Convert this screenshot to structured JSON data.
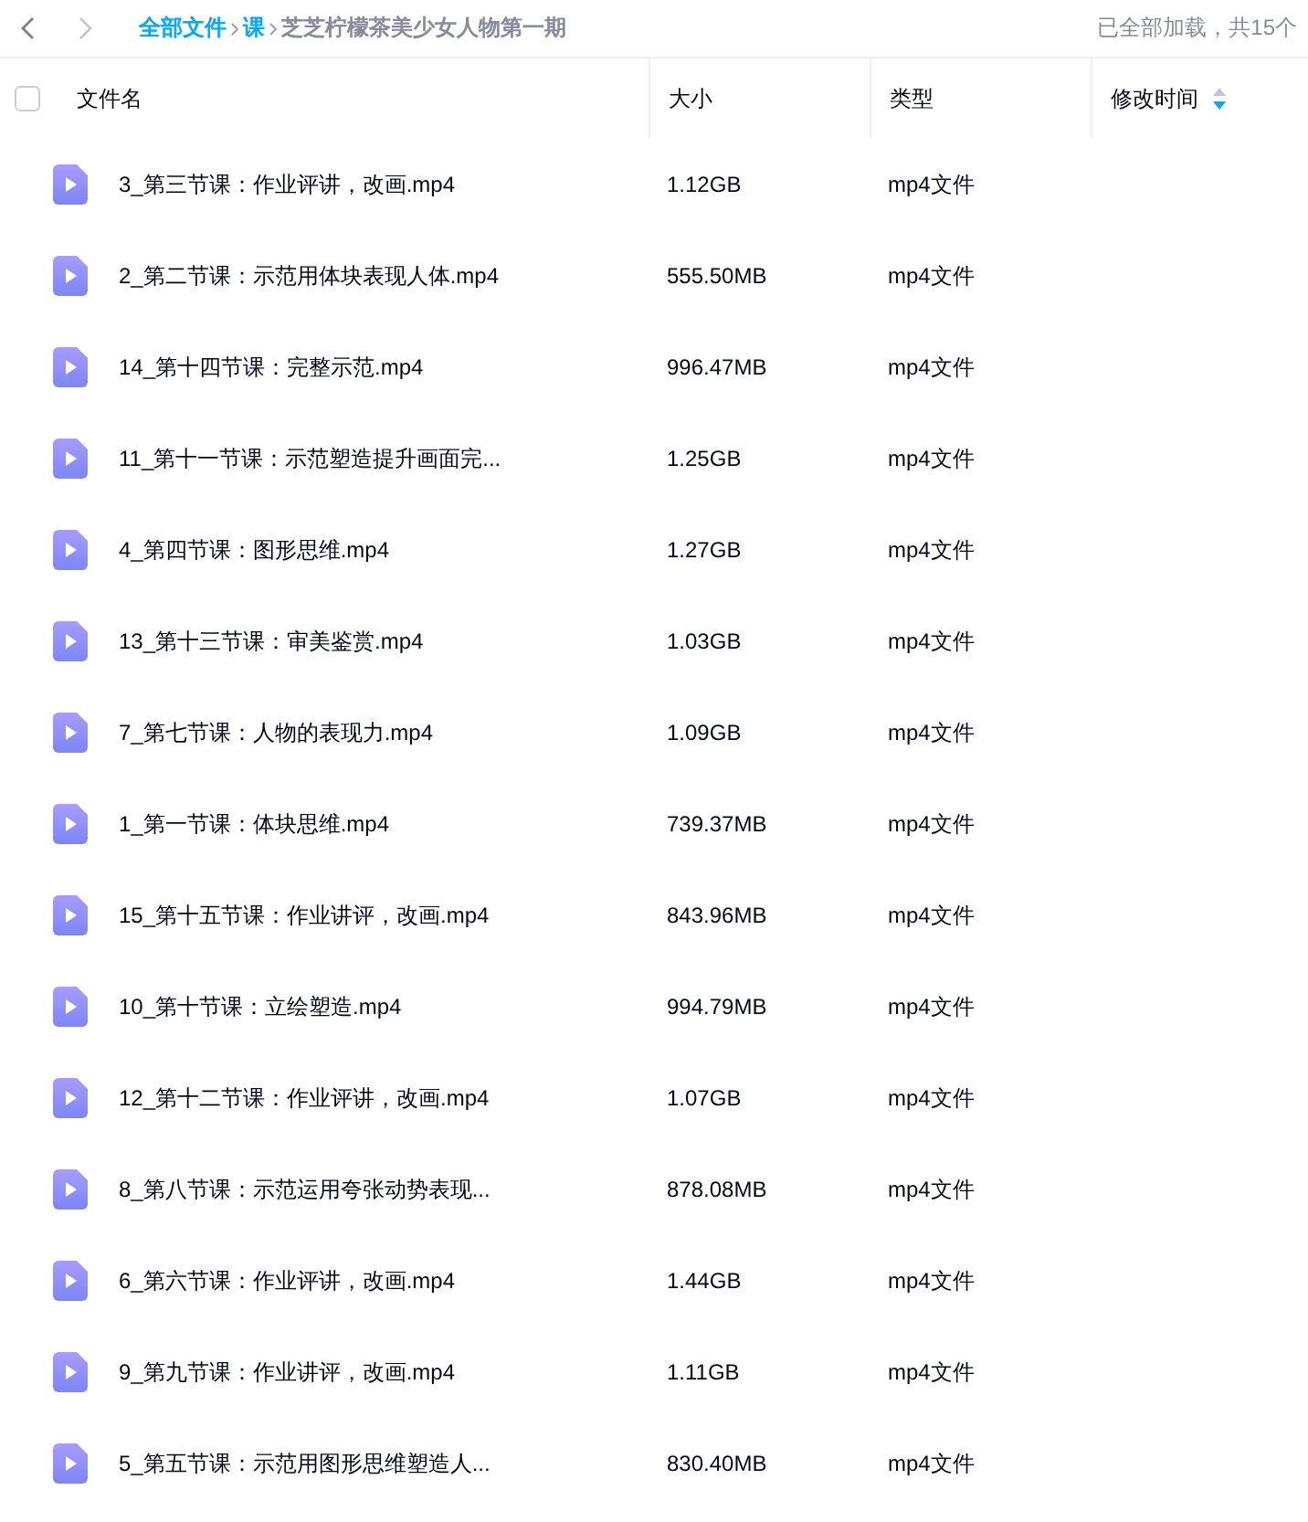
{
  "breadcrumb": [
    {
      "label": "全部文件",
      "kind": "link"
    },
    {
      "label": "课",
      "kind": "link"
    },
    {
      "label": "芝芝柠檬茶美少女人物第一期",
      "kind": "current"
    }
  ],
  "status": "已全部加载，共15个",
  "select_all": {
    "checked": false
  },
  "columns": [
    {
      "label": "文件名"
    },
    {
      "label": "大小"
    },
    {
      "label": "类型"
    },
    {
      "label": "修改时间",
      "sorted_descending": true
    }
  ],
  "rows": [
    {
      "name": "3_第三节课：作业评讲，改画.mp4",
      "size": "1.12GB",
      "type": "mp4文件"
    },
    {
      "name": "2_第二节课：示范用体块表现人体.mp4",
      "size": "555.50MB",
      "type": "mp4文件"
    },
    {
      "name": "14_第十四节课：完整示范.mp4",
      "size": "996.47MB",
      "type": "mp4文件"
    },
    {
      "name": "11_第十一节课：示范塑造提升画面完...",
      "size": "1.25GB",
      "type": "mp4文件"
    },
    {
      "name": "4_第四节课：图形思维.mp4",
      "size": "1.27GB",
      "type": "mp4文件"
    },
    {
      "name": "13_第十三节课：审美鉴赏.mp4",
      "size": "1.03GB",
      "type": "mp4文件"
    },
    {
      "name": "7_第七节课：人物的表现力.mp4",
      "size": "1.09GB",
      "type": "mp4文件"
    },
    {
      "name": "1_第一节课：体块思维.mp4",
      "size": "739.37MB",
      "type": "mp4文件"
    },
    {
      "name": "15_第十五节课：作业讲评，改画.mp4",
      "size": "843.96MB",
      "type": "mp4文件"
    },
    {
      "name": "10_第十节课：立绘塑造.mp4",
      "size": "994.79MB",
      "type": "mp4文件"
    },
    {
      "name": "12_第十二节课：作业评讲，改画.mp4",
      "size": "1.07GB",
      "type": "mp4文件"
    },
    {
      "name": "8_第八节课：示范运用夸张动势表现...",
      "size": "878.08MB",
      "type": "mp4文件"
    },
    {
      "name": "6_第六节课：作业评讲，改画.mp4",
      "size": "1.44GB",
      "type": "mp4文件"
    },
    {
      "name": "9_第九节课：作业讲评，改画.mp4",
      "size": "1.11GB",
      "type": "mp4文件"
    },
    {
      "name": "5_第五节课：示范用图形思维塑造人...",
      "size": "830.40MB",
      "type": "mp4文件"
    }
  ]
}
